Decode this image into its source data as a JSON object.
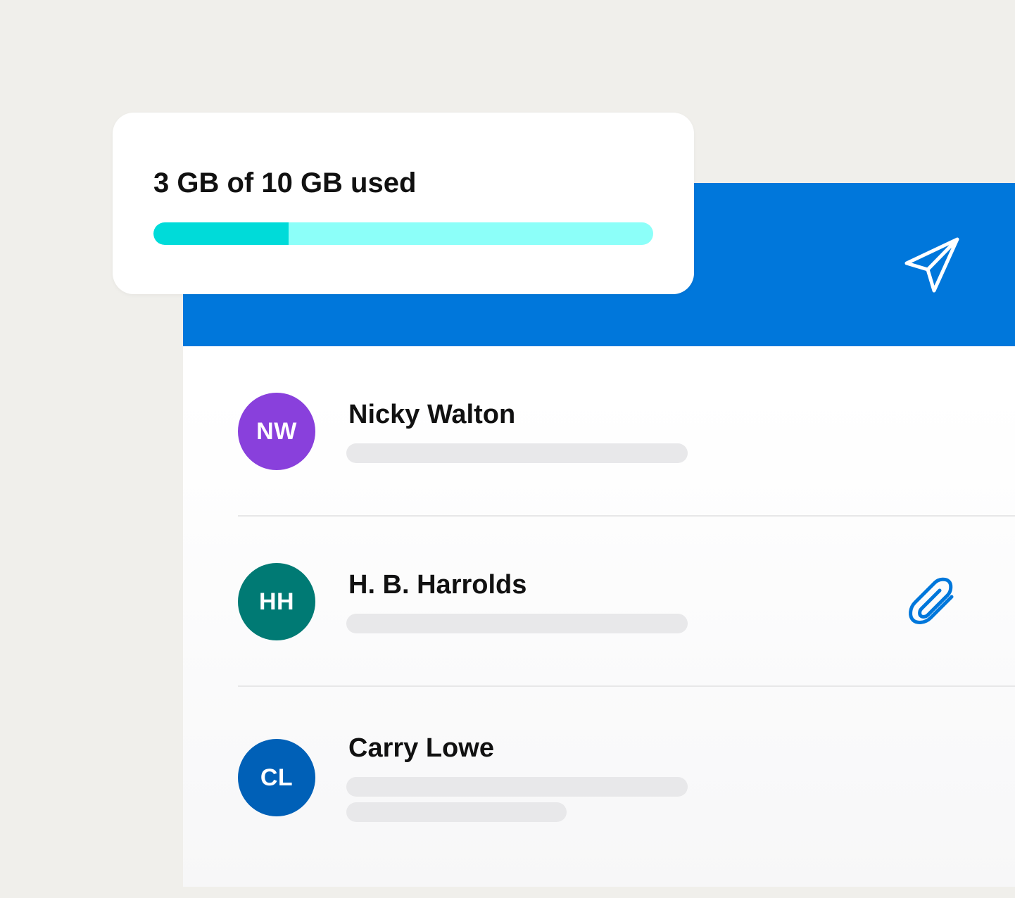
{
  "storage": {
    "label": "3 GB of 10 GB used",
    "used_gb": 3,
    "total_gb": 10,
    "used_fraction": 0.27,
    "fill_color": "#00dbd9",
    "track_color": "#8cfff9"
  },
  "header": {
    "background_color": "#0077db",
    "send_icon": "send-icon"
  },
  "messages": [
    {
      "initials": "NW",
      "sender": "Nicky Walton",
      "avatar_color": "#8940dc",
      "has_attachment": false,
      "preview_lines": 1
    },
    {
      "initials": "HH",
      "sender": "H. B. Harrolds",
      "avatar_color": "#007a74",
      "has_attachment": true,
      "attachment_icon": "paperclip-icon",
      "preview_lines": 1
    },
    {
      "initials": "CL",
      "sender": "Carry Lowe",
      "avatar_color": "#0060b7",
      "has_attachment": false,
      "preview_lines": 2
    }
  ]
}
